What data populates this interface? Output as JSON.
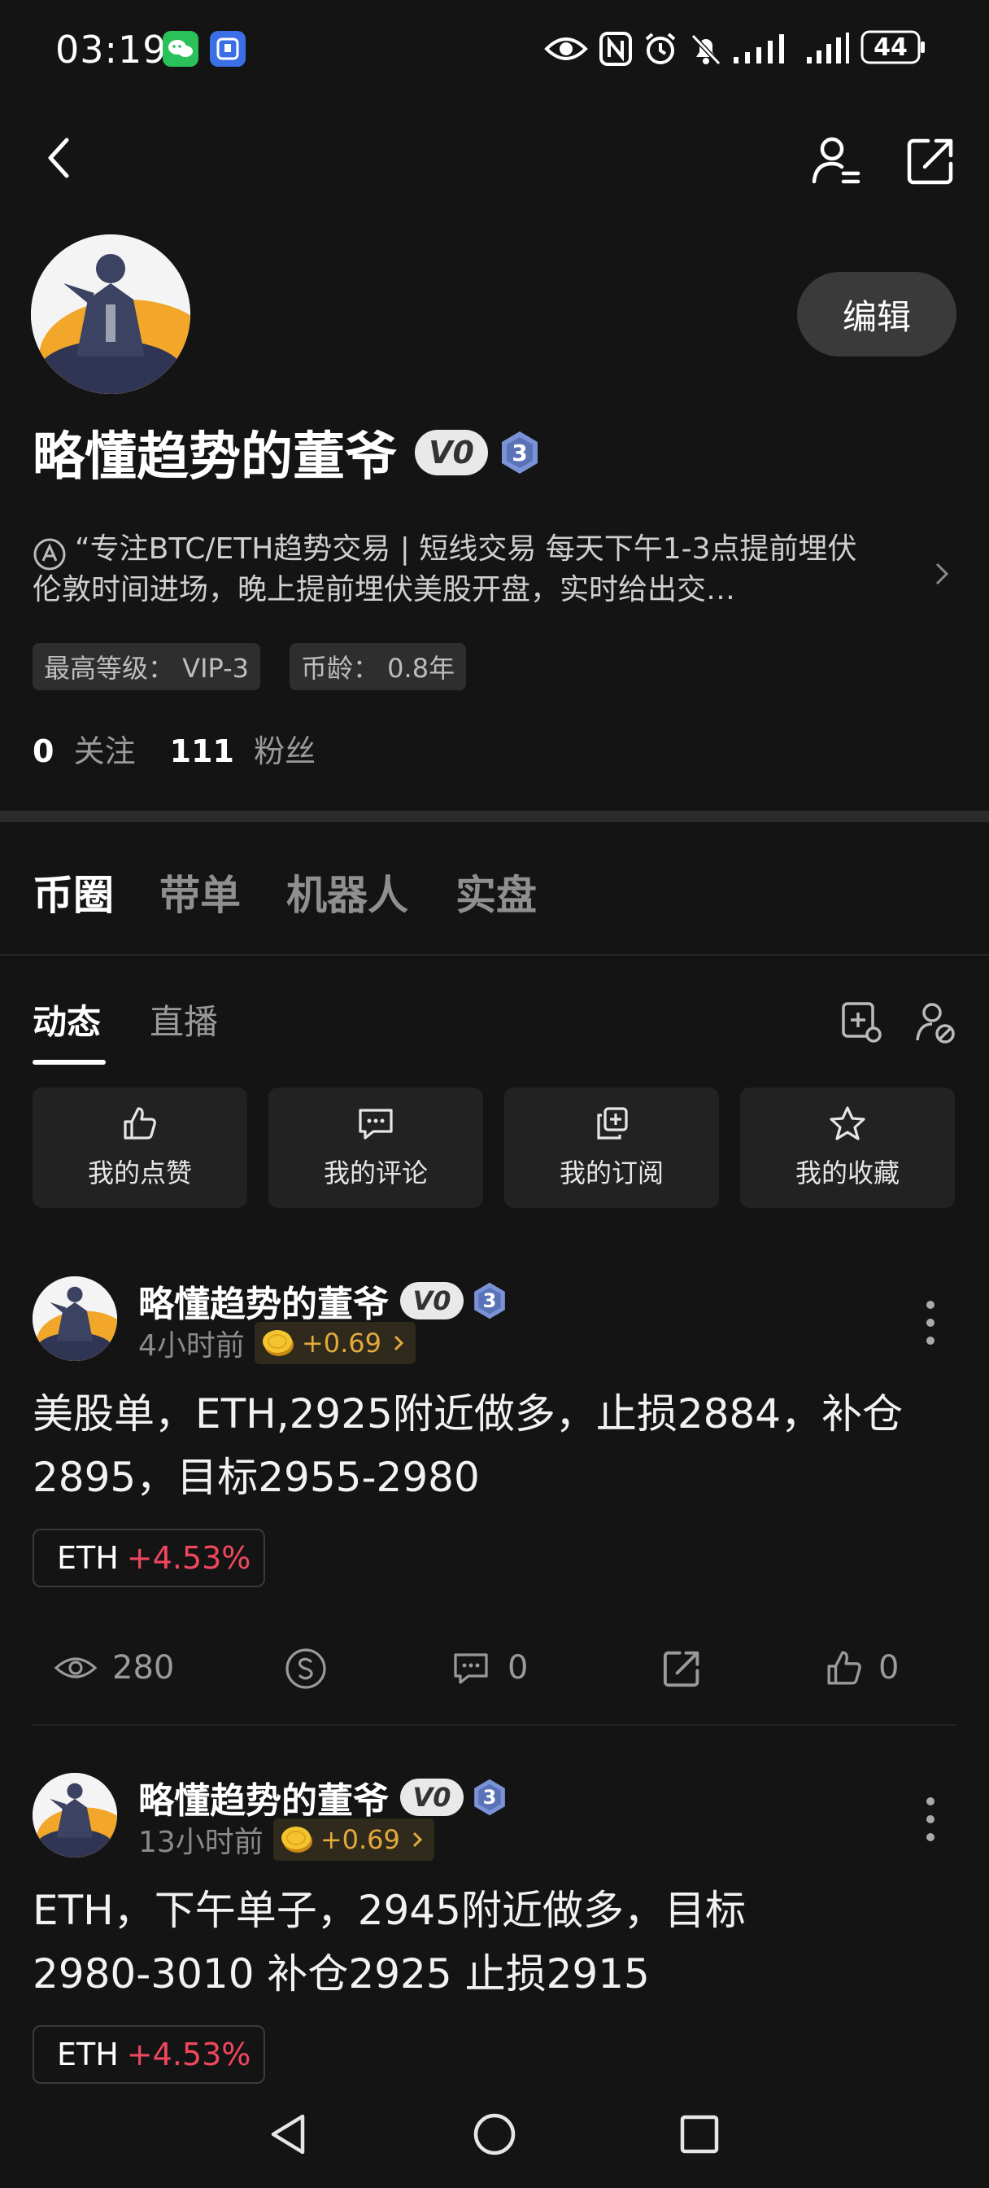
{
  "status_bar": {
    "time": "03:19",
    "battery": "44",
    "icons": [
      "wechat-icon",
      "app-notification-icon",
      "eye-icon",
      "nfc-icon",
      "alarm-icon",
      "mute-icon",
      "signal-icon",
      "signal-icon",
      "battery-icon"
    ]
  },
  "header": {
    "back_icon": "chevron-left-icon",
    "profile_icon": "user-settings-icon",
    "share_icon": "share-icon"
  },
  "profile": {
    "username": "略懂趋势的董爷",
    "vip_badge": "V0",
    "level_badge": "3",
    "edit_label": "编辑",
    "bio": "“专注BTC/ETH趋势交易 | 短线交易 每天下午1-3点提前埋伏伦敦时间进场，晚上提前埋伏美股开盘，实时给出交…",
    "tags": [
      "最高等级：  VIP-3",
      "币龄：  0.8年"
    ],
    "following_count": "0",
    "following_label": "关注",
    "followers_count": "111",
    "followers_label": "粉丝"
  },
  "main_tabs": [
    "币圈",
    "带单",
    "机器人",
    "实盘"
  ],
  "sub_tabs": [
    "动态",
    "直播"
  ],
  "actions": [
    {
      "label": "我的点赞",
      "icon": "thumbs-up-icon"
    },
    {
      "label": "我的评论",
      "icon": "comment-icon"
    },
    {
      "label": "我的订阅",
      "icon": "subscribe-icon"
    },
    {
      "label": "我的收藏",
      "icon": "star-icon"
    }
  ],
  "posts": [
    {
      "author": "略懂趋势的董爷",
      "vip": "V0",
      "level": "3",
      "time": "4小时前",
      "coin_change": "+0.69",
      "text_line1": "美股单，ETH,2925附近做多，止损2884，补仓",
      "text_line2": "2895，目标2955-2980",
      "ticker": "ETH",
      "ticker_change": "+4.53%",
      "views": "280",
      "comments": "0",
      "likes": "0"
    },
    {
      "author": "略懂趋势的董爷",
      "vip": "V0",
      "level": "3",
      "time": "13小时前",
      "coin_change": "+0.69",
      "text_line1": "ETH，下午单子，2945附近做多，目标",
      "text_line2": "2980-3010 补仓2925 止损2915",
      "ticker": "ETH",
      "ticker_change": "+4.53%"
    }
  ],
  "colors": {
    "background": "#141414",
    "positive_red": "#f0475e",
    "coin_gold": "#e3a93a",
    "badge_blue": "#6f86c9"
  }
}
